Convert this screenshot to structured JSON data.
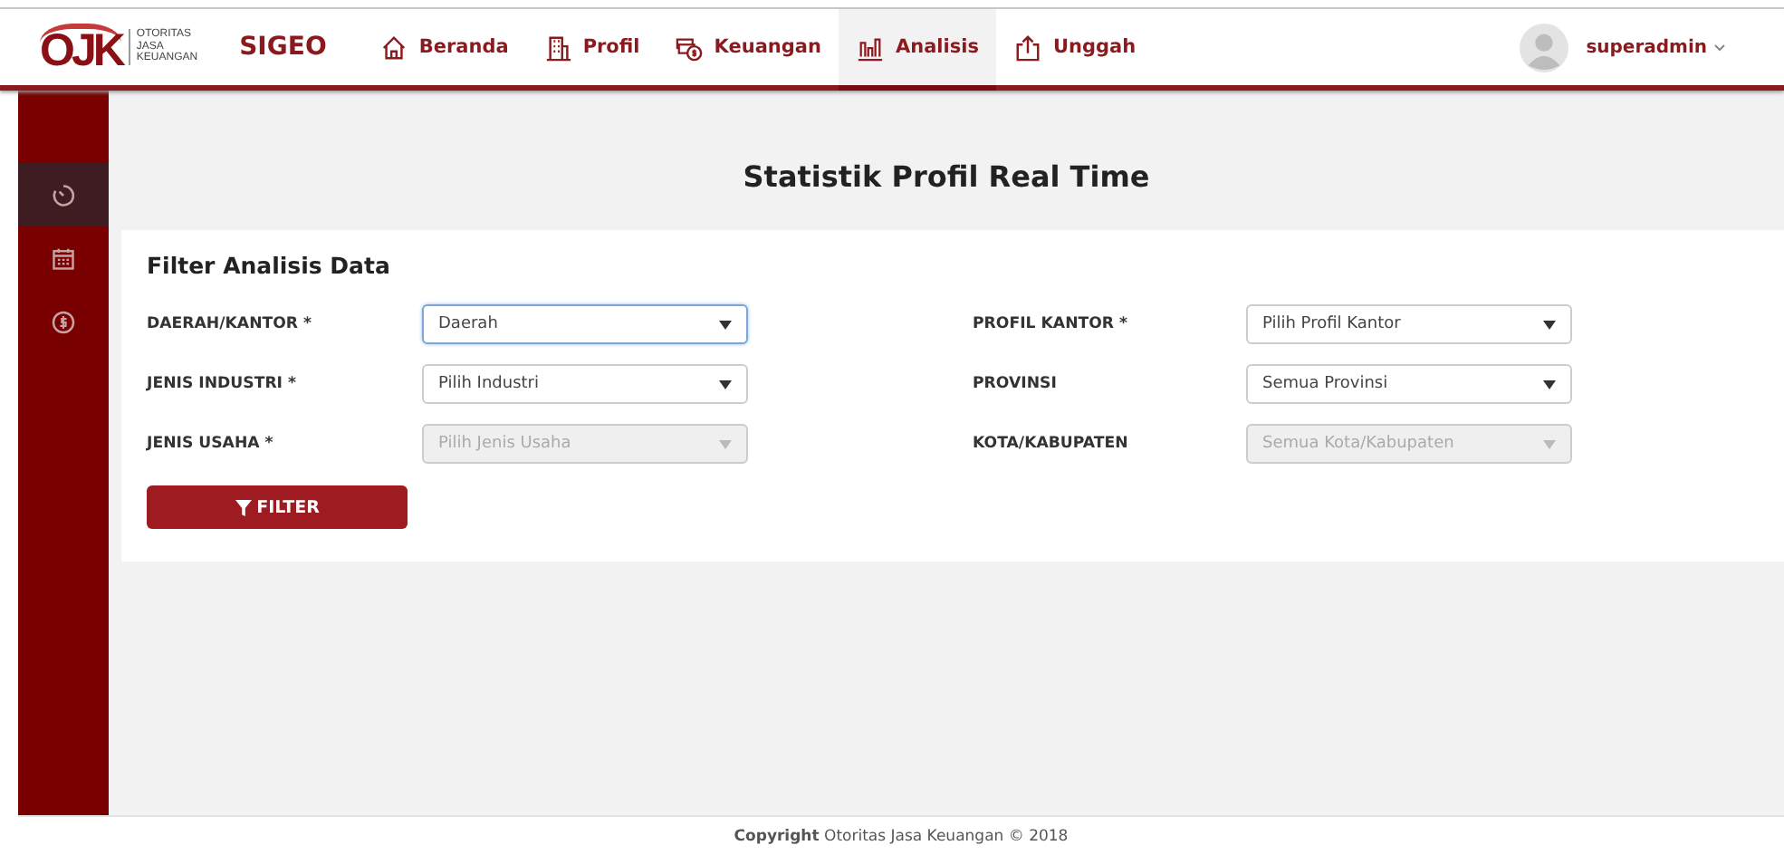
{
  "header": {
    "logo": {
      "mark": "OJK",
      "lines": [
        "OTORITAS",
        "JASA",
        "KEUANGAN"
      ]
    },
    "app_name": "SIGEO",
    "nav": [
      {
        "label": "Beranda",
        "kind": "home",
        "selected": false
      },
      {
        "label": "Profil",
        "kind": "building",
        "selected": false
      },
      {
        "label": "Keuangan",
        "kind": "money",
        "selected": false
      },
      {
        "label": "Analisis",
        "kind": "chart",
        "selected": true
      },
      {
        "label": "Unggah",
        "kind": "upload",
        "selected": false
      }
    ],
    "user": {
      "name": "superadmin"
    }
  },
  "sidebar": {
    "items": [
      {
        "kind": "timer",
        "selected": true
      },
      {
        "kind": "calendar",
        "selected": false
      },
      {
        "kind": "coin",
        "selected": false
      }
    ]
  },
  "page_title": "Statistik Profil Real Time",
  "filter": {
    "title": "Filter Analisis Data",
    "fields": [
      {
        "label": "DAERAH/KANTOR *",
        "value": "Daerah",
        "focused": true,
        "disabled": false
      },
      {
        "label": "PROFIL KANTOR *",
        "value": "Pilih Profil Kantor",
        "focused": false,
        "disabled": false
      },
      {
        "label": "JENIS INDUSTRI *",
        "value": "Pilih Industri",
        "focused": false,
        "disabled": false
      },
      {
        "label": "PROVINSI",
        "value": "Semua Provinsi",
        "focused": false,
        "disabled": false
      },
      {
        "label": "JENIS USAHA *",
        "value": "Pilih Jenis Usaha",
        "focused": false,
        "disabled": true
      },
      {
        "label": "KOTA/KABUPATEN",
        "value": "Semua Kota/Kabupaten",
        "focused": false,
        "disabled": true
      }
    ],
    "button": "FILTER"
  },
  "footer": "**Copyright** Otoritas Jasa Keuangan © 2018"
}
